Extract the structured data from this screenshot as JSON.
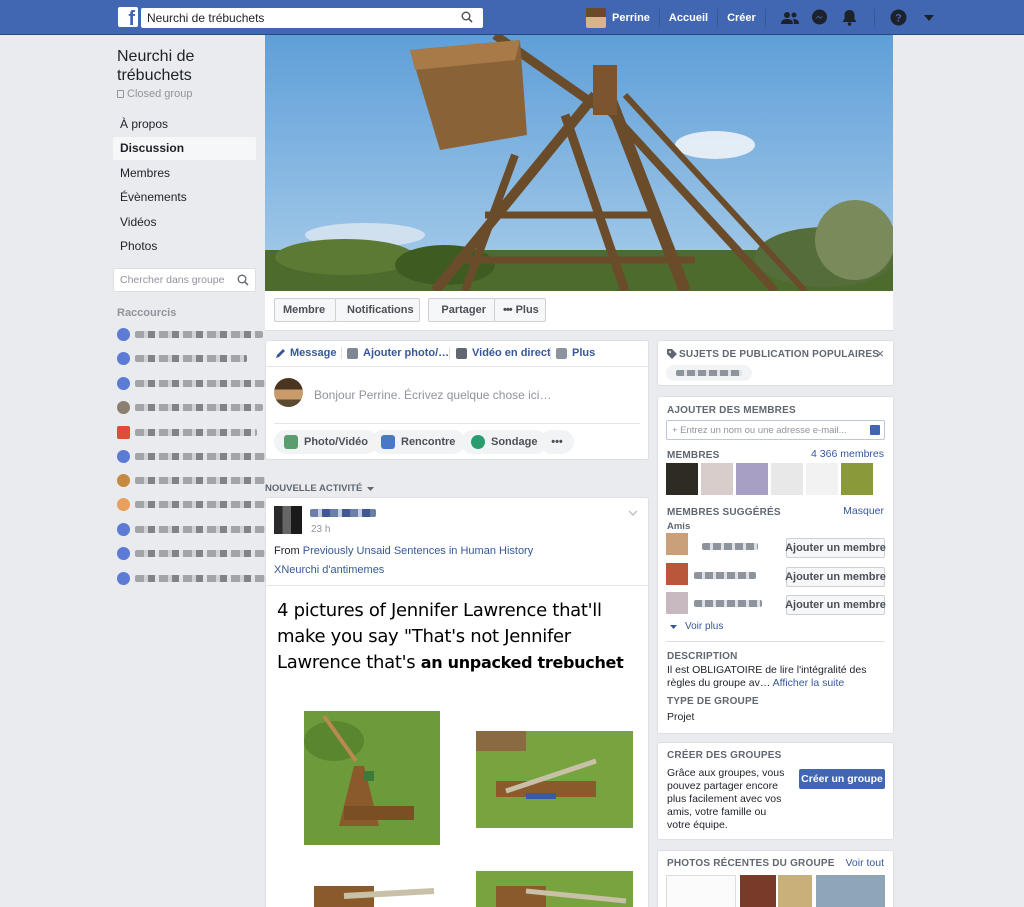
{
  "topbar": {
    "search_value": "Neurchi de trébuchets",
    "user_name": "Perrine",
    "home_label": "Accueil",
    "create_label": "Créer"
  },
  "group": {
    "title": "Neurchi de trébuchets",
    "privacy": "Closed group"
  },
  "left_nav": [
    "À propos",
    "Discussion",
    "Membres",
    "Évènements",
    "Vidéos",
    "Photos"
  ],
  "group_search_placeholder": "Chercher dans groupe",
  "shortcuts_title": "Raccourcis",
  "action_bar": {
    "member": "Membre",
    "notifications": "Notifications",
    "share": "Partager",
    "more": "Plus"
  },
  "composer": {
    "tabs": [
      "Message",
      "Ajouter photo/…",
      "Vidéo en direct",
      "Plus"
    ],
    "placeholder": "Bonjour Perrine. Écrivez quelque chose ici…",
    "buttons": [
      "Photo/Vidéo",
      "Rencontre",
      "Sondage",
      "•••"
    ]
  },
  "feed": {
    "section_title": "NOUVELLE ACTIVITÉ",
    "post": {
      "time": "23 h",
      "from_prefix": "From ",
      "from_link": "Previously Unsaid Sentences in Human History",
      "shared_to": "XNeurchi d'antimemes",
      "meme_line1": "4 pictures of Jennifer Lawrence that'll",
      "meme_line2": "make you say \"That's not Jennifer",
      "meme_line3": "Lawrence that's ",
      "meme_bold": "an unpacked trebuchet"
    }
  },
  "right": {
    "topics_title": "SUJETS DE PUBLICATION POPULAIRES",
    "add_members_title": "AJOUTER DES MEMBRES",
    "add_members_placeholder": "+ Entrez un nom ou une adresse e-mail...",
    "members_label": "MEMBRES",
    "members_count": "4 366 membres",
    "suggested_title": "MEMBRES SUGGÉRÉS",
    "hide_label": "Masquer",
    "friends_label": "Amis",
    "add_member_btn": "Ajouter un membre",
    "see_more": "Voir plus",
    "description_title": "DESCRIPTION",
    "description_text": "Il est OBLIGATOIRE de lire l'intégralité des règles du groupe av…",
    "show_more": "Afficher la suite",
    "group_type_title": "TYPE DE GROUPE",
    "group_type": "Projet",
    "create_groups_title": "CRÉER DES GROUPES",
    "create_groups_text": "Grâce aux groupes, vous pouvez partager encore plus facilement avec vos amis, votre famille ou votre équipe.",
    "create_group_btn": "Créer un groupe",
    "recent_photos_title": "PHOTOS RÉCENTES DU GROUPE",
    "see_all": "Voir tout"
  },
  "colors": {
    "brand_blue": "#4267b2",
    "link_blue": "#365899",
    "background": "#e9ebee"
  }
}
